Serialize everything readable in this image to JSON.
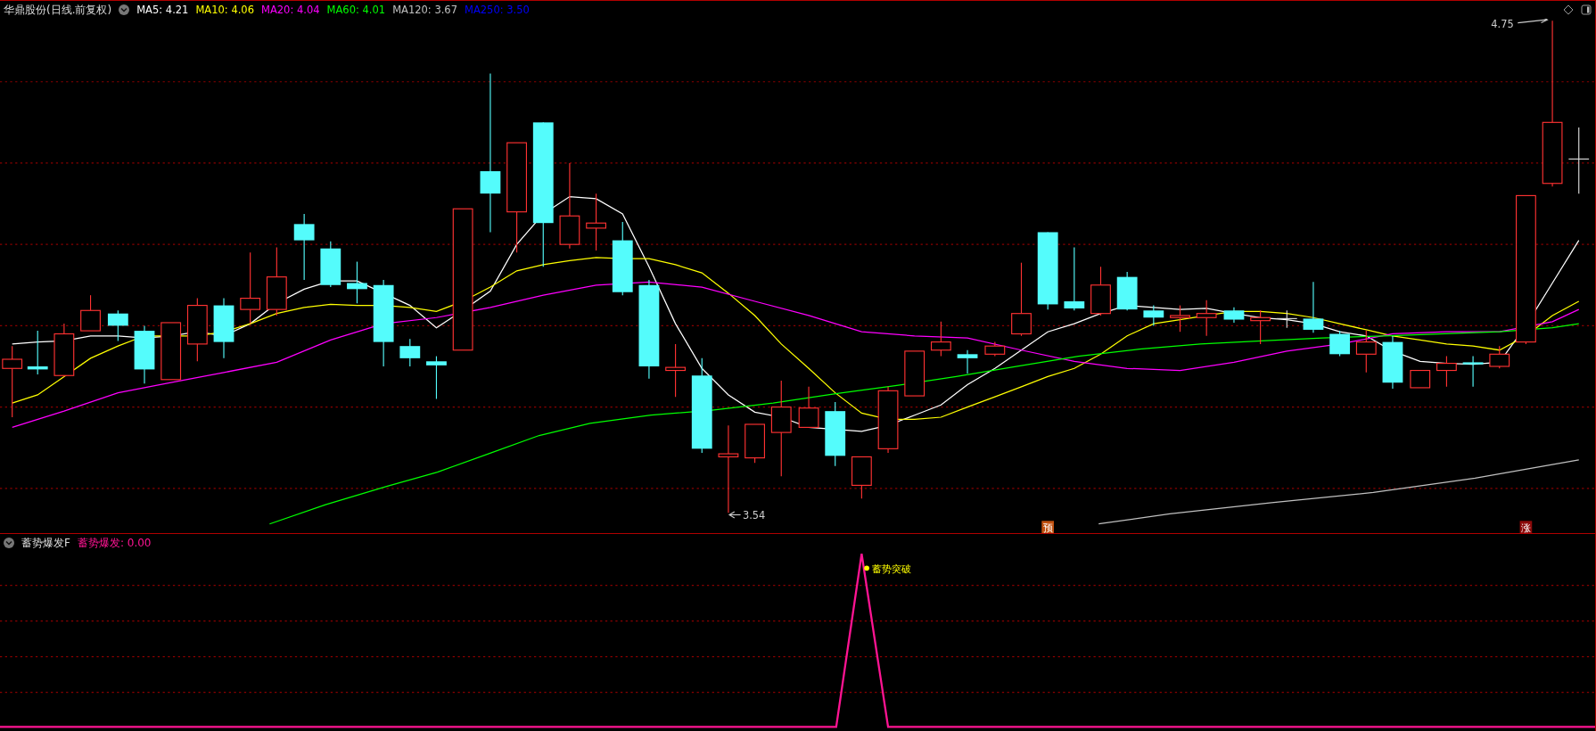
{
  "main_panel": {
    "title": "华鼎股份(日线.前复权)",
    "ma_legend": [
      {
        "label": "MA5: 4.21",
        "color": "#ffffff"
      },
      {
        "label": "MA10: 4.06",
        "color": "#ffff00"
      },
      {
        "label": "MA20: 4.04",
        "color": "#ff00ff"
      },
      {
        "label": "MA60: 4.01",
        "color": "#00ff00"
      },
      {
        "label": "MA120: 3.67",
        "color": "#c0c0c0"
      },
      {
        "label": "MA250: 3.50",
        "color": "#0000ff"
      }
    ],
    "high_label": "4.75",
    "low_label": "3.54",
    "signals": [
      {
        "text": "预",
        "color": "#c0500f"
      },
      {
        "text": "涨",
        "color": "#8b0a0a"
      }
    ]
  },
  "indicator_panel": {
    "title": "蓄势爆发F",
    "reading": "蓄势爆发: 0.00",
    "signal_label": "蓄势突破"
  }
}
